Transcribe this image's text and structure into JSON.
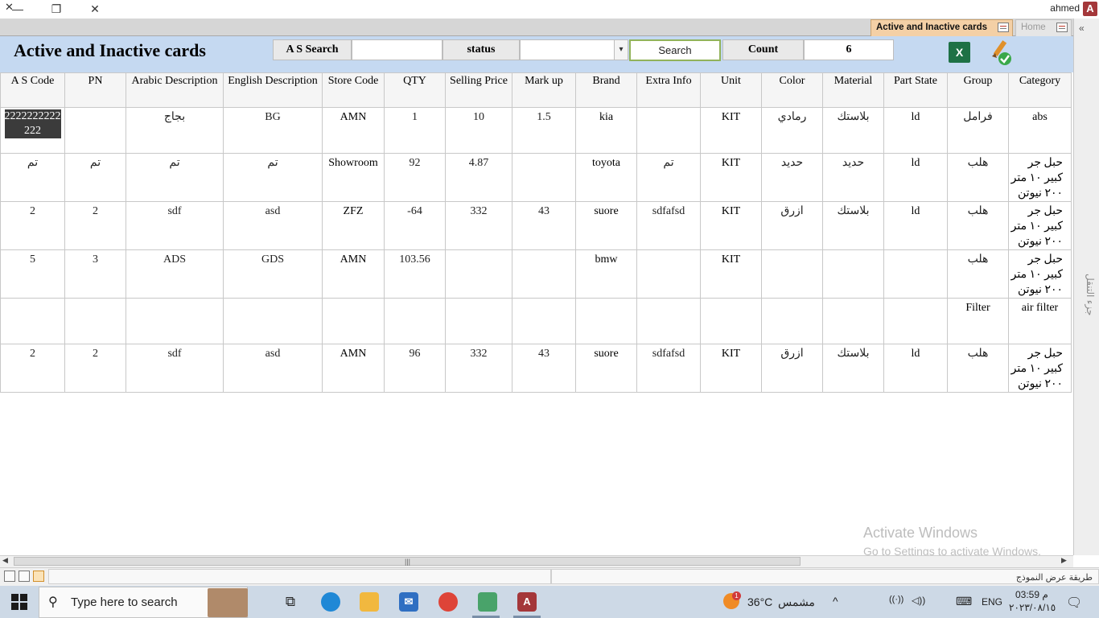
{
  "window": {
    "user": "ahmed",
    "app_logo": "A",
    "min_glyph": "—",
    "restore_glyph": "❐",
    "close_glyph": "✕"
  },
  "tabs": {
    "close_glyph": "✕",
    "active": "Active and Inactive cards",
    "home": "Home"
  },
  "nav_pane": {
    "toggle": "«",
    "label": "جزء التنقل"
  },
  "form": {
    "title": "Active and Inactive cards",
    "as_search_label": "A S Search",
    "as_search_value": "",
    "status_label": "status",
    "status_value": "",
    "status_arrow": "▾",
    "search_button": "Search",
    "count_label": "Count",
    "count_value": "6",
    "excel_letter": "X"
  },
  "table": {
    "columns": [
      "A S Code",
      "PN",
      "Arabic Description",
      "English Description",
      "Store Code",
      "QTY",
      "Selling Price",
      "Mark up",
      "Brand",
      "Extra Info",
      "Unit",
      "Color",
      "Material",
      "Part State",
      "Group",
      "Category"
    ],
    "rows": [
      [
        "2222222222222",
        "",
        "بجاج",
        "BG",
        "AMN",
        "1",
        "10",
        "1.5",
        "kia",
        "",
        "KIT",
        "رمادي",
        "بلاستك",
        "ld",
        "فرامل",
        "abs"
      ],
      [
        "تم",
        "تم",
        "تم",
        "تم",
        "Showroom",
        "92",
        "4.87",
        "",
        "toyota",
        "تم",
        "KIT",
        "حديد",
        "حديد",
        "ld",
        "هلب",
        "حبل جر كبير ١٠ متر ٢٠٠ نيوتن"
      ],
      [
        "2",
        "2",
        "sdf",
        "asd",
        "ZFZ",
        "-64",
        "332",
        "43",
        "suore",
        "sdfafsd",
        "KIT",
        "ازرق",
        "بلاستك",
        "ld",
        "هلب",
        "حبل جر كبير ١٠ متر ٢٠٠ نيوتن"
      ],
      [
        "5",
        "3",
        "ADS",
        "GDS",
        "AMN",
        "103.56",
        "",
        "",
        "bmw",
        "",
        "KIT",
        "",
        "",
        "",
        "هلب",
        "حبل جر كبير ١٠ متر ٢٠٠ نيوتن"
      ],
      [
        "",
        "",
        "",
        "",
        "",
        "",
        "",
        "",
        "",
        "",
        "",
        "",
        "",
        "",
        "Filter",
        "air filter"
      ],
      [
        "2",
        "2",
        "sdf",
        "asd",
        "AMN",
        "96",
        "332",
        "43",
        "suore",
        "sdfafsd",
        "KIT",
        "ازرق",
        "بلاستك",
        "ld",
        "هلب",
        "حبل جر كبير ١٠ متر ٢٠٠ نيوتن"
      ]
    ]
  },
  "scrollbar": {
    "left": "◀",
    "right": "▶",
    "grip": "|||"
  },
  "status_bar": {
    "view_text": "طريقة عرض النموذج"
  },
  "watermark": {
    "line1": "Activate Windows",
    "line2": "Go to Settings to activate Windows."
  },
  "taskbar": {
    "search_icon": "⚲",
    "search_placeholder": "Type here to search",
    "taskview": "⧉",
    "mail_glyph": "✉",
    "access_letter": "A",
    "badge": "1",
    "temperature": "36°C",
    "condition": "مشمس",
    "tray_up": "^",
    "tray_wifi": "((·))",
    "tray_volume": "◁))",
    "tray_keyboard": "⌨",
    "language": "ENG",
    "time": "03:59 م",
    "date": "٢٠٢٣/٠٨/١٥",
    "notify": "🗨"
  },
  "colors": {
    "header_bg": "#c5d9f1",
    "active_tab": "#f4d0a6",
    "search_border": "#92b35a",
    "excel_green": "#1e7145",
    "access_red": "#a4373a"
  }
}
